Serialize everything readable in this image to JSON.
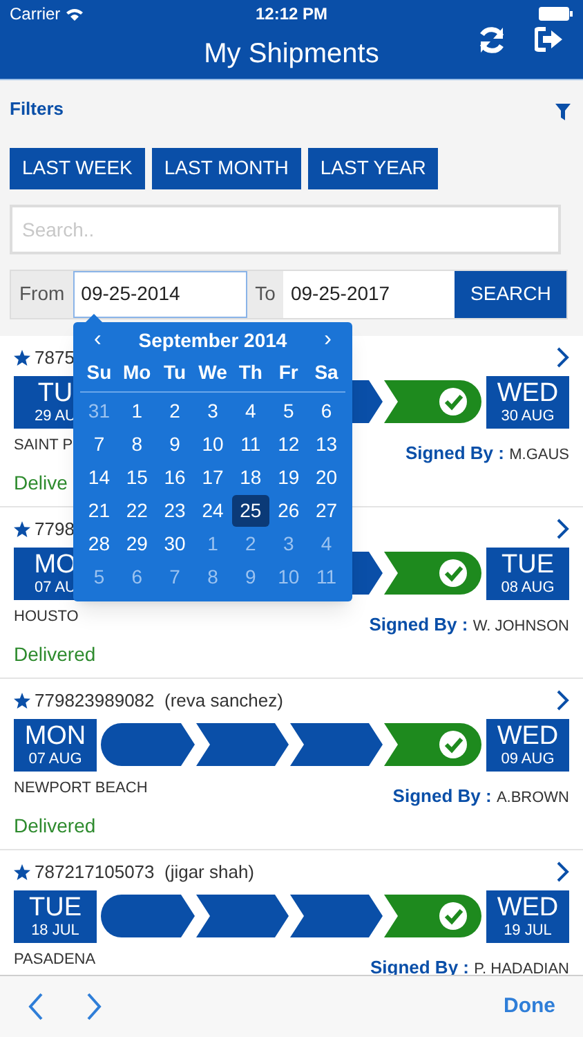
{
  "status_bar": {
    "carrier": "Carrier",
    "time": "12:12 PM"
  },
  "nav": {
    "title": "My Shipments"
  },
  "filters": {
    "title": "Filters",
    "quick_ranges": [
      {
        "label": "LAST WEEK"
      },
      {
        "label": "LAST MONTH"
      },
      {
        "label": "LAST YEAR"
      }
    ],
    "search": {
      "placeholder": "Search.."
    },
    "from_label": "From",
    "from_value": "09-25-2014",
    "to_label": "To",
    "to_value": "09-25-2017",
    "search_button": "SEARCH"
  },
  "shipments": [
    {
      "tracking": "7875",
      "start_day": "TU",
      "start_date": "29 AU",
      "end_day": "WED",
      "end_date": "30 AUG",
      "city": "SAINT P",
      "signed_label": "Signed By :",
      "signer": "M.GAUS",
      "status": "Delive",
      "delivered": true
    },
    {
      "tracking": "7798",
      "start_day": "MO",
      "start_date": "07 AU",
      "end_day": "TUE",
      "end_date": "08 AUG",
      "city": "HOUSTO",
      "signed_label": "Signed By :",
      "signer": "W. JOHNSON",
      "status": "Delivered",
      "delivered": true
    },
    {
      "tracking": "779823989082  (reva sanchez)",
      "start_day": "MON",
      "start_date": "07 AUG",
      "end_day": "WED",
      "end_date": "09 AUG",
      "city": "NEWPORT BEACH",
      "signed_label": "Signed By :",
      "signer": "A.BROWN",
      "status": "Delivered",
      "delivered": true
    },
    {
      "tracking": "787217105073  (jigar shah)",
      "start_day": "TUE",
      "start_date": "18 JUL",
      "end_day": "WED",
      "end_date": "19 JUL",
      "city": "PASADENA",
      "signed_label": "Signed By :",
      "signer": "P. HADADIAN",
      "delivered": true
    }
  ],
  "calendar": {
    "prev": "‹",
    "next": "›",
    "month": "September 2014",
    "weekdays": [
      "Su",
      "Mo",
      "Tu",
      "We",
      "Th",
      "Fr",
      "Sa"
    ],
    "weeks": [
      [
        {
          "day": "31",
          "outside": true,
          "selected": false
        },
        {
          "day": "1",
          "outside": false,
          "selected": false
        },
        {
          "day": "2",
          "outside": false,
          "selected": false
        },
        {
          "day": "3",
          "outside": false,
          "selected": false
        },
        {
          "day": "4",
          "outside": false,
          "selected": false
        },
        {
          "day": "5",
          "outside": false,
          "selected": false
        },
        {
          "day": "6",
          "outside": false,
          "selected": false
        }
      ],
      [
        {
          "day": "7",
          "outside": false,
          "selected": false
        },
        {
          "day": "8",
          "outside": false,
          "selected": false
        },
        {
          "day": "9",
          "outside": false,
          "selected": false
        },
        {
          "day": "10",
          "outside": false,
          "selected": false
        },
        {
          "day": "11",
          "outside": false,
          "selected": false
        },
        {
          "day": "12",
          "outside": false,
          "selected": false
        },
        {
          "day": "13",
          "outside": false,
          "selected": false
        }
      ],
      [
        {
          "day": "14",
          "outside": false,
          "selected": false
        },
        {
          "day": "15",
          "outside": false,
          "selected": false
        },
        {
          "day": "16",
          "outside": false,
          "selected": false
        },
        {
          "day": "17",
          "outside": false,
          "selected": false
        },
        {
          "day": "18",
          "outside": false,
          "selected": false
        },
        {
          "day": "19",
          "outside": false,
          "selected": false
        },
        {
          "day": "20",
          "outside": false,
          "selected": false
        }
      ],
      [
        {
          "day": "21",
          "outside": false,
          "selected": false
        },
        {
          "day": "22",
          "outside": false,
          "selected": false
        },
        {
          "day": "23",
          "outside": false,
          "selected": false
        },
        {
          "day": "24",
          "outside": false,
          "selected": false
        },
        {
          "day": "25",
          "outside": false,
          "selected": true
        },
        {
          "day": "26",
          "outside": false,
          "selected": false
        },
        {
          "day": "27",
          "outside": false,
          "selected": false
        }
      ],
      [
        {
          "day": "28",
          "outside": false,
          "selected": false
        },
        {
          "day": "29",
          "outside": false,
          "selected": false
        },
        {
          "day": "30",
          "outside": false,
          "selected": false
        },
        {
          "day": "1",
          "outside": true,
          "selected": false
        },
        {
          "day": "2",
          "outside": true,
          "selected": false
        },
        {
          "day": "3",
          "outside": true,
          "selected": false
        },
        {
          "day": "4",
          "outside": true,
          "selected": false
        }
      ],
      [
        {
          "day": "5",
          "outside": true,
          "selected": false
        },
        {
          "day": "6",
          "outside": true,
          "selected": false
        },
        {
          "day": "7",
          "outside": true,
          "selected": false
        },
        {
          "day": "8",
          "outside": true,
          "selected": false
        },
        {
          "day": "9",
          "outside": true,
          "selected": false
        },
        {
          "day": "10",
          "outside": true,
          "selected": false
        },
        {
          "day": "11",
          "outside": true,
          "selected": false
        }
      ]
    ]
  },
  "toolbar": {
    "done": "Done"
  }
}
